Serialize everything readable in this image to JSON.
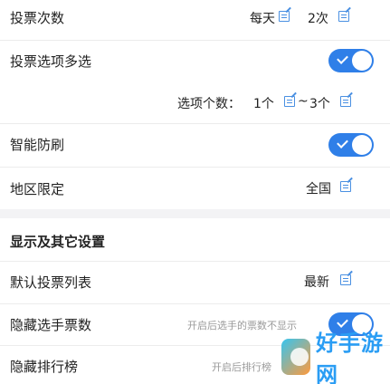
{
  "rows": {
    "vote_count": {
      "label": "投票次数",
      "freq": "每天",
      "times": "2次"
    },
    "multi_select": {
      "label": "投票选项多选"
    },
    "option_count": {
      "prefix": "选项个数：",
      "min": "1个",
      "sep": "~",
      "max": "3个"
    },
    "smart_protect": {
      "label": "智能防刷"
    },
    "region": {
      "label": "地区限定",
      "value": "全国"
    }
  },
  "section": {
    "title": "显示及其它设置"
  },
  "rows2": {
    "default_list": {
      "label": "默认投票列表",
      "value": "最新"
    },
    "hide_votes": {
      "label": "隐藏选手票数",
      "hint": "开启后选手的票数不显示"
    },
    "hide_rank": {
      "label": "隐藏排行榜",
      "hint": "开启后排行榜"
    }
  },
  "watermark": {
    "text": "好手游网"
  },
  "colors": {
    "accent": "#2f7fe8",
    "edit_icon": "#4a90e2",
    "section_bg": "#f3f3f5"
  }
}
